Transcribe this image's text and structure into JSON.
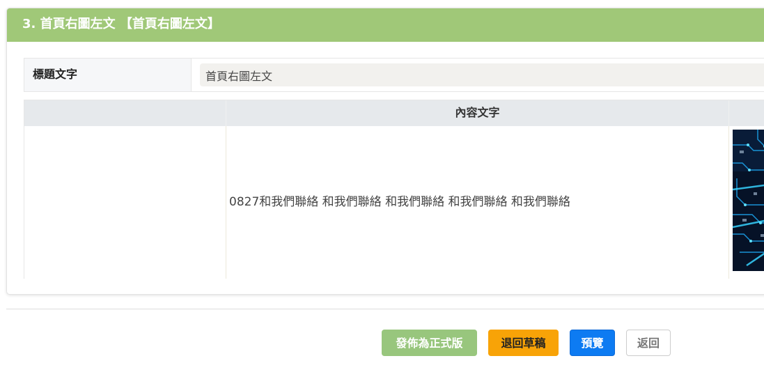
{
  "section": {
    "title": "3. 首頁右圖左文 【首頁右圖左文】"
  },
  "title_field": {
    "label": "標題文字",
    "value": "首頁右圖左文"
  },
  "content_table": {
    "header": "內容文字",
    "content_text": "0827和我們聯絡 和我們聯絡 和我們聯絡 和我們聯絡 和我們聯絡",
    "image": "circuit-board-image"
  },
  "actions": {
    "publish_label": "發佈為正式版",
    "draft_label": "退回草稿",
    "preview_label": "預覽",
    "back_label": "返回"
  },
  "colors": {
    "header_green": "#a0c878",
    "publish_green": "#98c67d",
    "draft_orange": "#f8a307",
    "preview_blue": "#0d7bf2"
  }
}
